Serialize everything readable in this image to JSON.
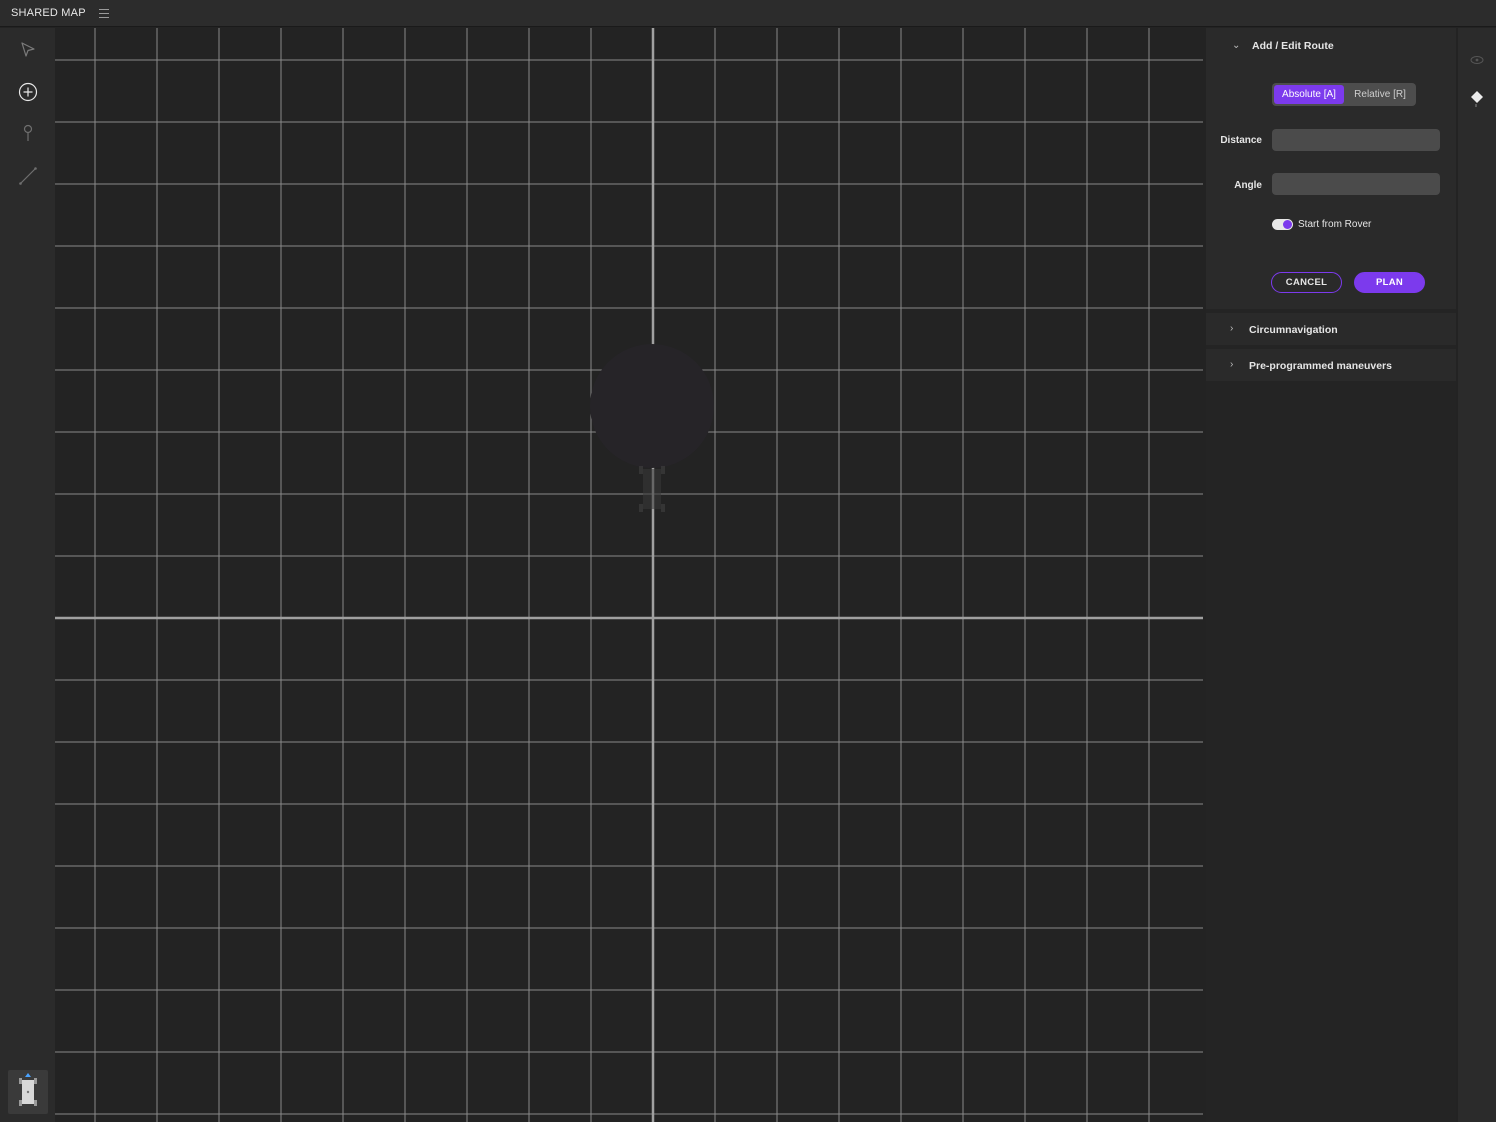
{
  "app": {
    "title": "SHARED MAP"
  },
  "toolbar": {
    "tools": [
      {
        "name": "select-pointer-icon",
        "active": false
      },
      {
        "name": "add-circle-icon",
        "active": true
      },
      {
        "name": "waypoint-pin-icon",
        "active": false
      },
      {
        "name": "measure-line-icon",
        "active": false
      }
    ]
  },
  "map": {
    "grid_color": "#8a8a8a",
    "axis_color": "#a0a0a0"
  },
  "panel": {
    "add_edit_route": {
      "title": "Add / Edit Route",
      "expanded": true,
      "mode_options": [
        "Absolute [A]",
        "Relative [R]"
      ],
      "mode_selected": "Absolute [A]",
      "distance_label": "Distance",
      "distance_value": "",
      "angle_label": "Angle",
      "angle_value": "",
      "start_from_rover_label": "Start from Rover",
      "start_from_rover": true,
      "cancel_label": "CANCEL",
      "plan_label": "PLAN"
    },
    "circumnavigation": {
      "title": "Circumnavigation",
      "expanded": false
    },
    "maneuvers": {
      "title": "Pre-programmed maneuvers",
      "expanded": false
    }
  },
  "colors": {
    "accent": "#7c3aed",
    "background": "#232323"
  }
}
